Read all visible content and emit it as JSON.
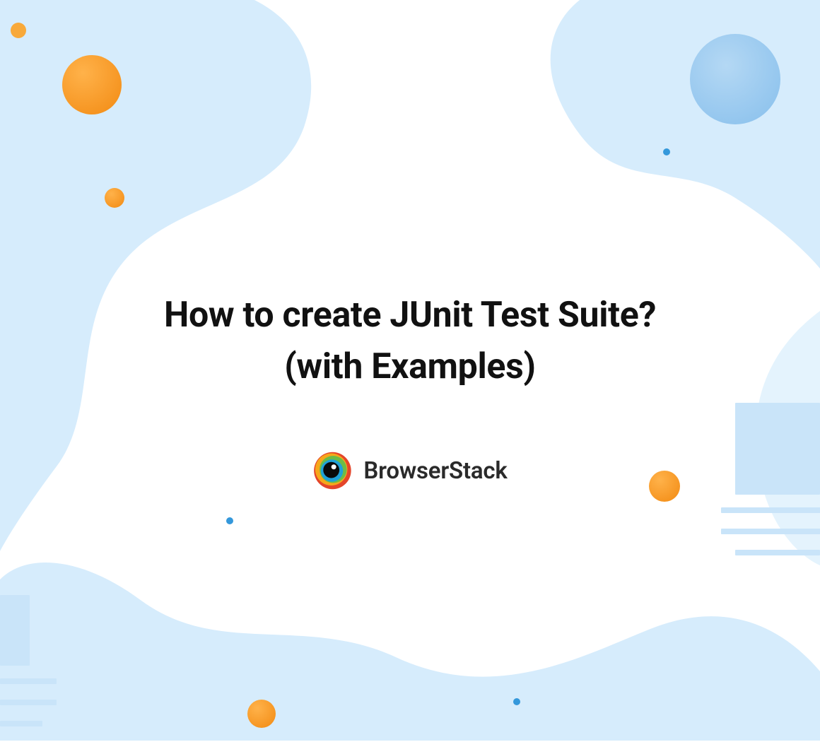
{
  "title": "How to create JUnit Test Suite? (with Examples)",
  "brand": {
    "name": "BrowserStack"
  },
  "colors": {
    "bg_light_blue": "#d6ecfc",
    "mid_blue": "#9bc8ef",
    "orange": "#f7941d",
    "orange_light": "#f8a93a",
    "dot_blue": "#3498db",
    "text_dark": "#111111"
  }
}
